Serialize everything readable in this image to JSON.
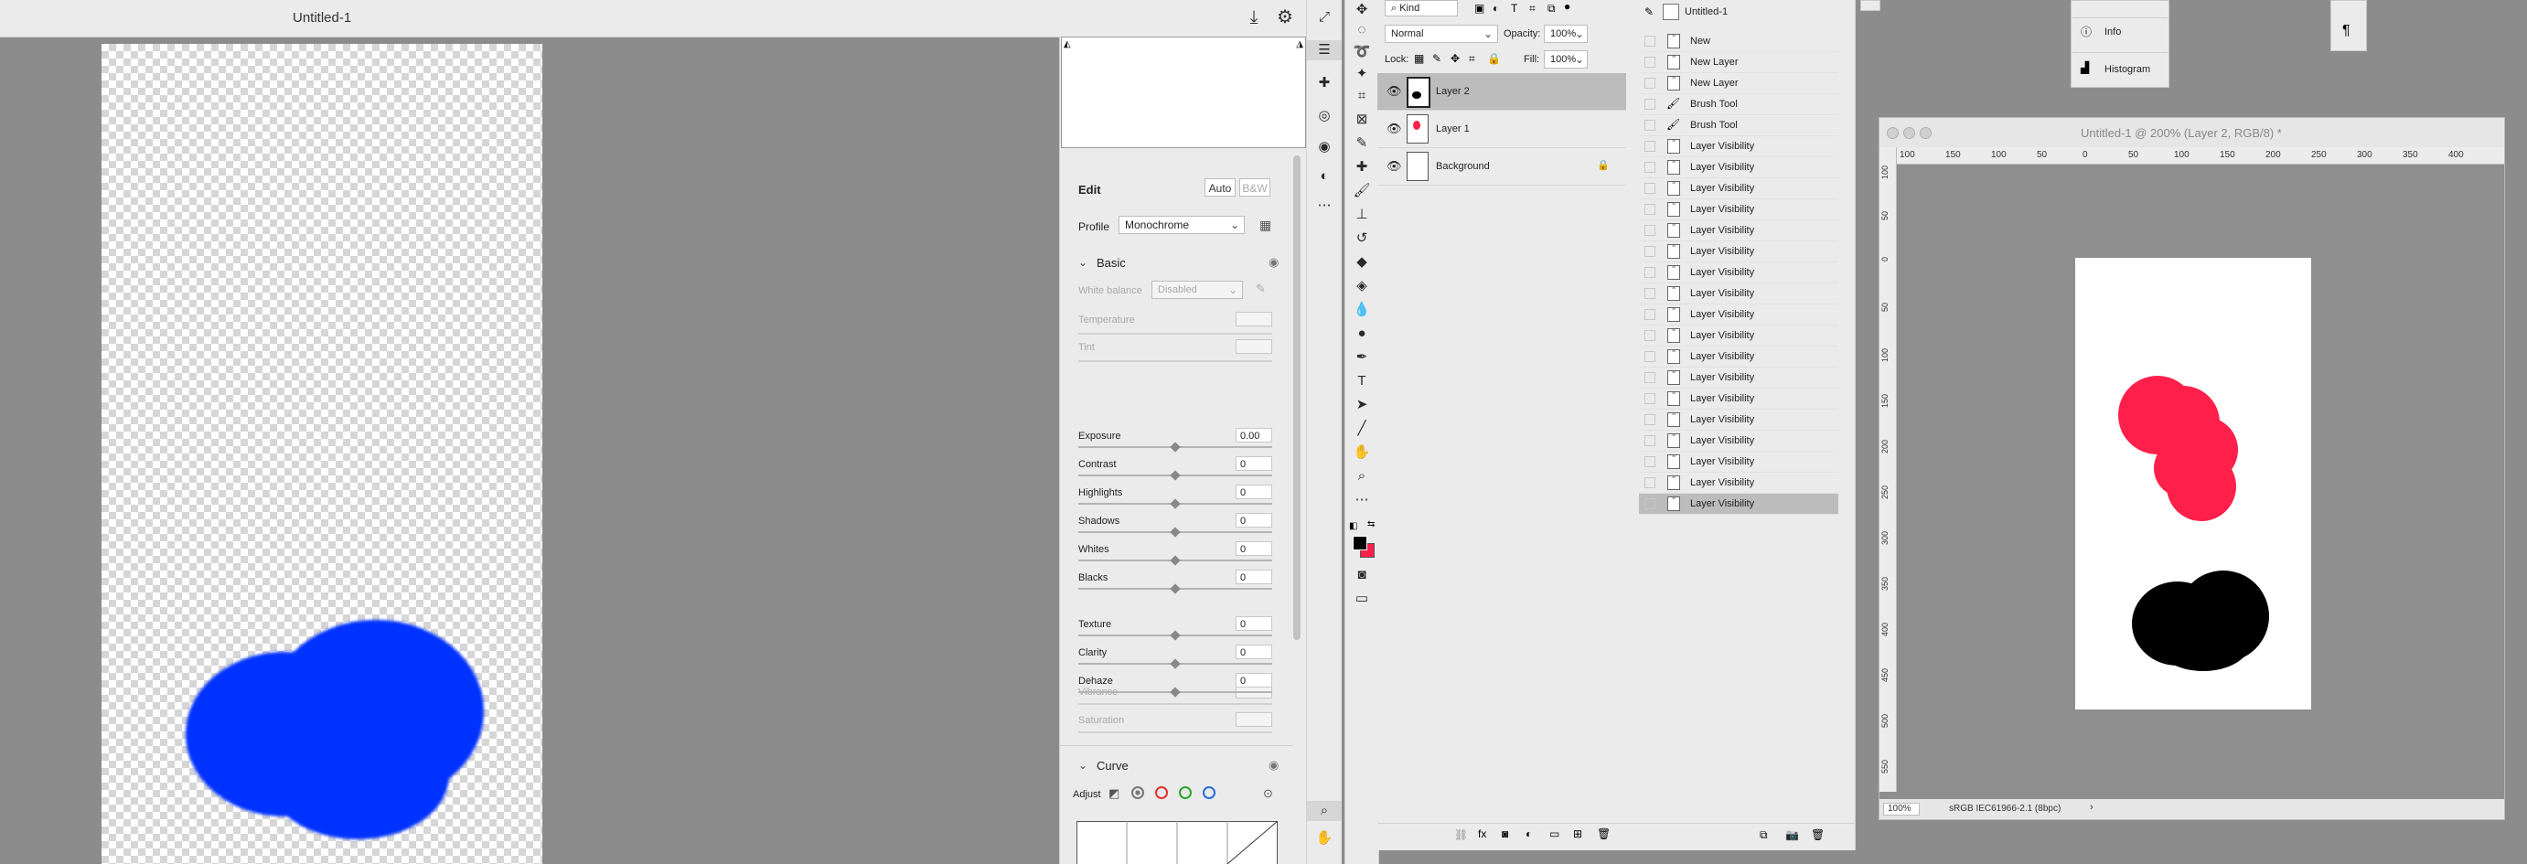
{
  "app": {
    "cr_title": "Untitled-1",
    "doc_title": "Untitled-1 @ 200% (Layer 2, RGB/8) *"
  },
  "camera_raw": {
    "edit_title": "Edit",
    "auto_label": "Auto",
    "bw_label": "B&W",
    "profile_label": "Profile",
    "profile_value": "Monochrome",
    "basic_label": "Basic",
    "white_balance_label": "White balance",
    "white_balance_value": "Disabled",
    "temperature_label": "Temperature",
    "tint_label": "Tint",
    "sliders": [
      {
        "label": "Exposure",
        "value": "0.00"
      },
      {
        "label": "Contrast",
        "value": "0"
      },
      {
        "label": "Highlights",
        "value": "0"
      },
      {
        "label": "Shadows",
        "value": "0"
      },
      {
        "label": "Whites",
        "value": "0"
      },
      {
        "label": "Blacks",
        "value": "0"
      },
      {
        "label": "Texture",
        "value": "0"
      },
      {
        "label": "Clarity",
        "value": "0"
      },
      {
        "label": "Dehaze",
        "value": "0"
      }
    ],
    "vibrance_label": "Vibrance",
    "saturation_label": "Saturation",
    "curve_label": "Curve",
    "adjust_label": "Adjust"
  },
  "layers": {
    "filter_kind": "Kind",
    "blend_mode": "Normal",
    "opacity_label": "Opacity:",
    "opacity_value": "100%",
    "lock_label": "Lock:",
    "fill_label": "Fill:",
    "fill_value": "100%",
    "items": [
      {
        "name": "Layer 2"
      },
      {
        "name": "Layer 1"
      },
      {
        "name": "Background"
      }
    ]
  },
  "history": {
    "doc_name": "Untitled-1",
    "items": [
      "New",
      "New Layer",
      "New Layer",
      "Brush Tool",
      "Brush Tool",
      "Layer Visibility",
      "Layer Visibility",
      "Layer Visibility",
      "Layer Visibility",
      "Layer Visibility",
      "Layer Visibility",
      "Layer Visibility",
      "Layer Visibility",
      "Layer Visibility",
      "Layer Visibility",
      "Layer Visibility",
      "Layer Visibility",
      "Layer Visibility",
      "Layer Visibility",
      "Layer Visibility",
      "Layer Visibility",
      "Layer Visibility",
      "Layer Visibility"
    ]
  },
  "mini_panels": {
    "info_label": "Info",
    "histogram_label": "Histogram"
  },
  "doc": {
    "ruler_top": [
      "100",
      "150",
      "100",
      "50",
      "0",
      "50",
      "100",
      "150",
      "200",
      "250",
      "300",
      "350",
      "400"
    ],
    "ruler_left": [
      "100",
      "50",
      "0",
      "50",
      "100",
      "150",
      "200",
      "250",
      "300",
      "350",
      "400",
      "450",
      "500",
      "550"
    ],
    "zoom": "100%",
    "color_profile": "sRGB IEC61966-2.1 (8bpc)"
  },
  "colors": {
    "blue_blob": "#0033ff",
    "red_blob": "#ff1f4b",
    "black_blob": "#000000"
  }
}
